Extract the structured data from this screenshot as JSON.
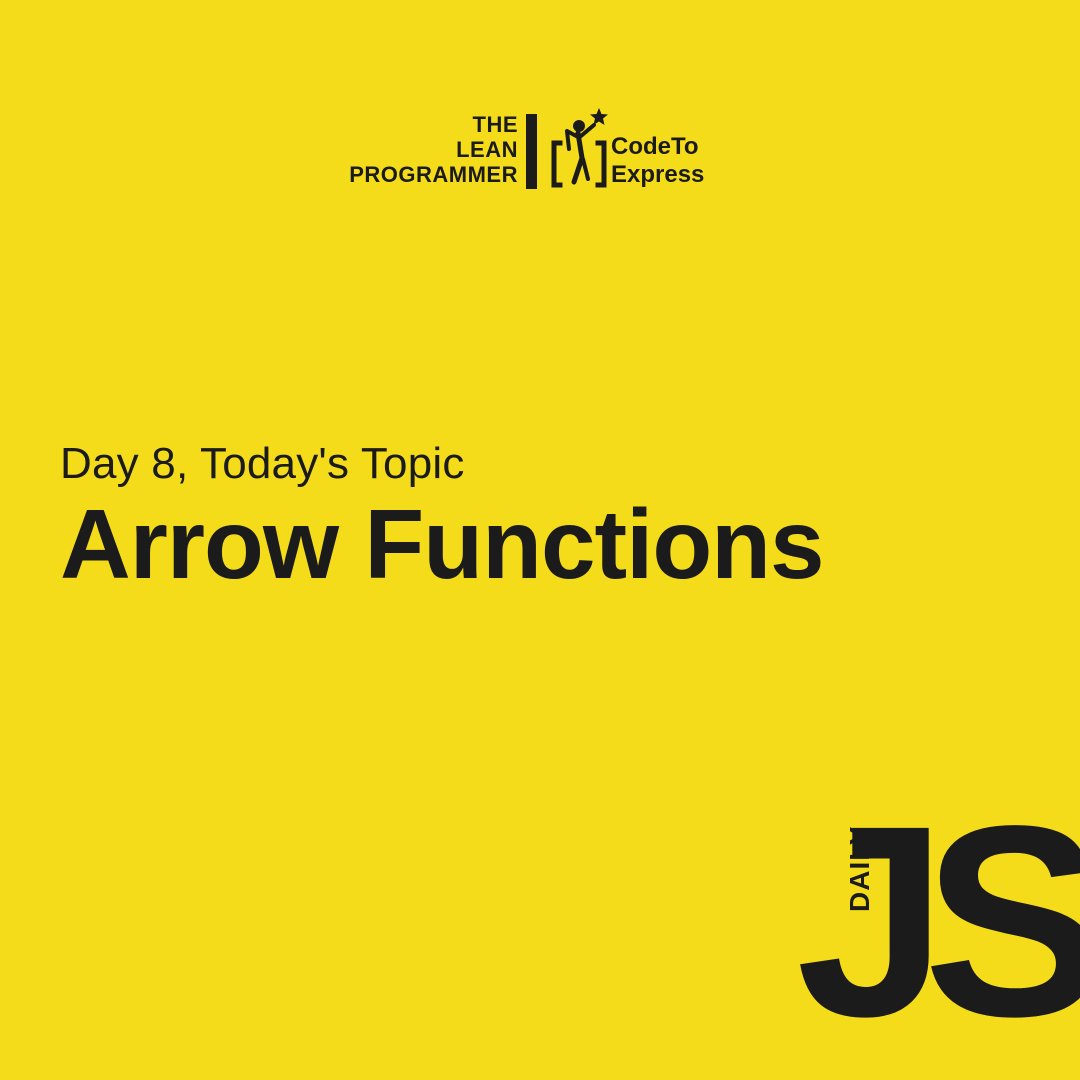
{
  "brand": {
    "lean_lines": [
      "THE",
      "LEAN",
      "PROGRAMMER"
    ],
    "code_lines": [
      "CodeTo",
      "Express"
    ]
  },
  "topic": {
    "kicker": "Day 8, Today's Topic",
    "title": "Arrow Functions"
  },
  "badge": {
    "daily": "DAILY",
    "js": "JS"
  },
  "colors": {
    "background": "#f5dc1b",
    "ink": "#1b1b1b"
  },
  "icons": {
    "code_to_express_logo": "code-to-express-icon"
  }
}
